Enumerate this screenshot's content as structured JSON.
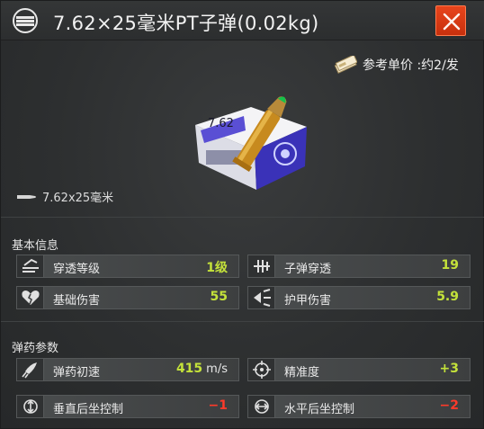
{
  "title": "7.62×25毫米PT子弹(0.02kg)",
  "reference_price": "参考单价 :约2/发",
  "caliber": "7.62x25毫米",
  "box_label": "7.62",
  "colors": {
    "accent_green": "#c4e23a",
    "accent_red": "#ff3a2a",
    "close": "#d63a12"
  },
  "sections": {
    "basic": {
      "title": "基本信息",
      "stats": [
        {
          "icon": "penetration-level-icon",
          "label": "穿透等级",
          "value": "1级",
          "color": "green"
        },
        {
          "icon": "bullet-penetration-icon",
          "label": "子弹穿透",
          "value": "19",
          "color": "green"
        },
        {
          "icon": "broken-heart-icon",
          "label": "基础伤害",
          "value": "55",
          "color": "green"
        },
        {
          "icon": "armor-damage-icon",
          "label": "护甲伤害",
          "value": "5.9",
          "color": "green"
        }
      ]
    },
    "ammo": {
      "title": "弹药参数",
      "stats": [
        {
          "icon": "muzzle-velocity-icon",
          "label": "弹药初速",
          "value": "415",
          "unit": "m/s",
          "color": "green"
        },
        {
          "icon": "crosshair-icon",
          "label": "精准度",
          "value": "+3",
          "color": "green"
        },
        {
          "icon": "vertical-recoil-icon",
          "label": "垂直后坐控制",
          "value": "−1",
          "color": "red"
        },
        {
          "icon": "horizontal-recoil-icon",
          "label": "水平后坐控制",
          "value": "−2",
          "color": "red"
        }
      ]
    }
  }
}
